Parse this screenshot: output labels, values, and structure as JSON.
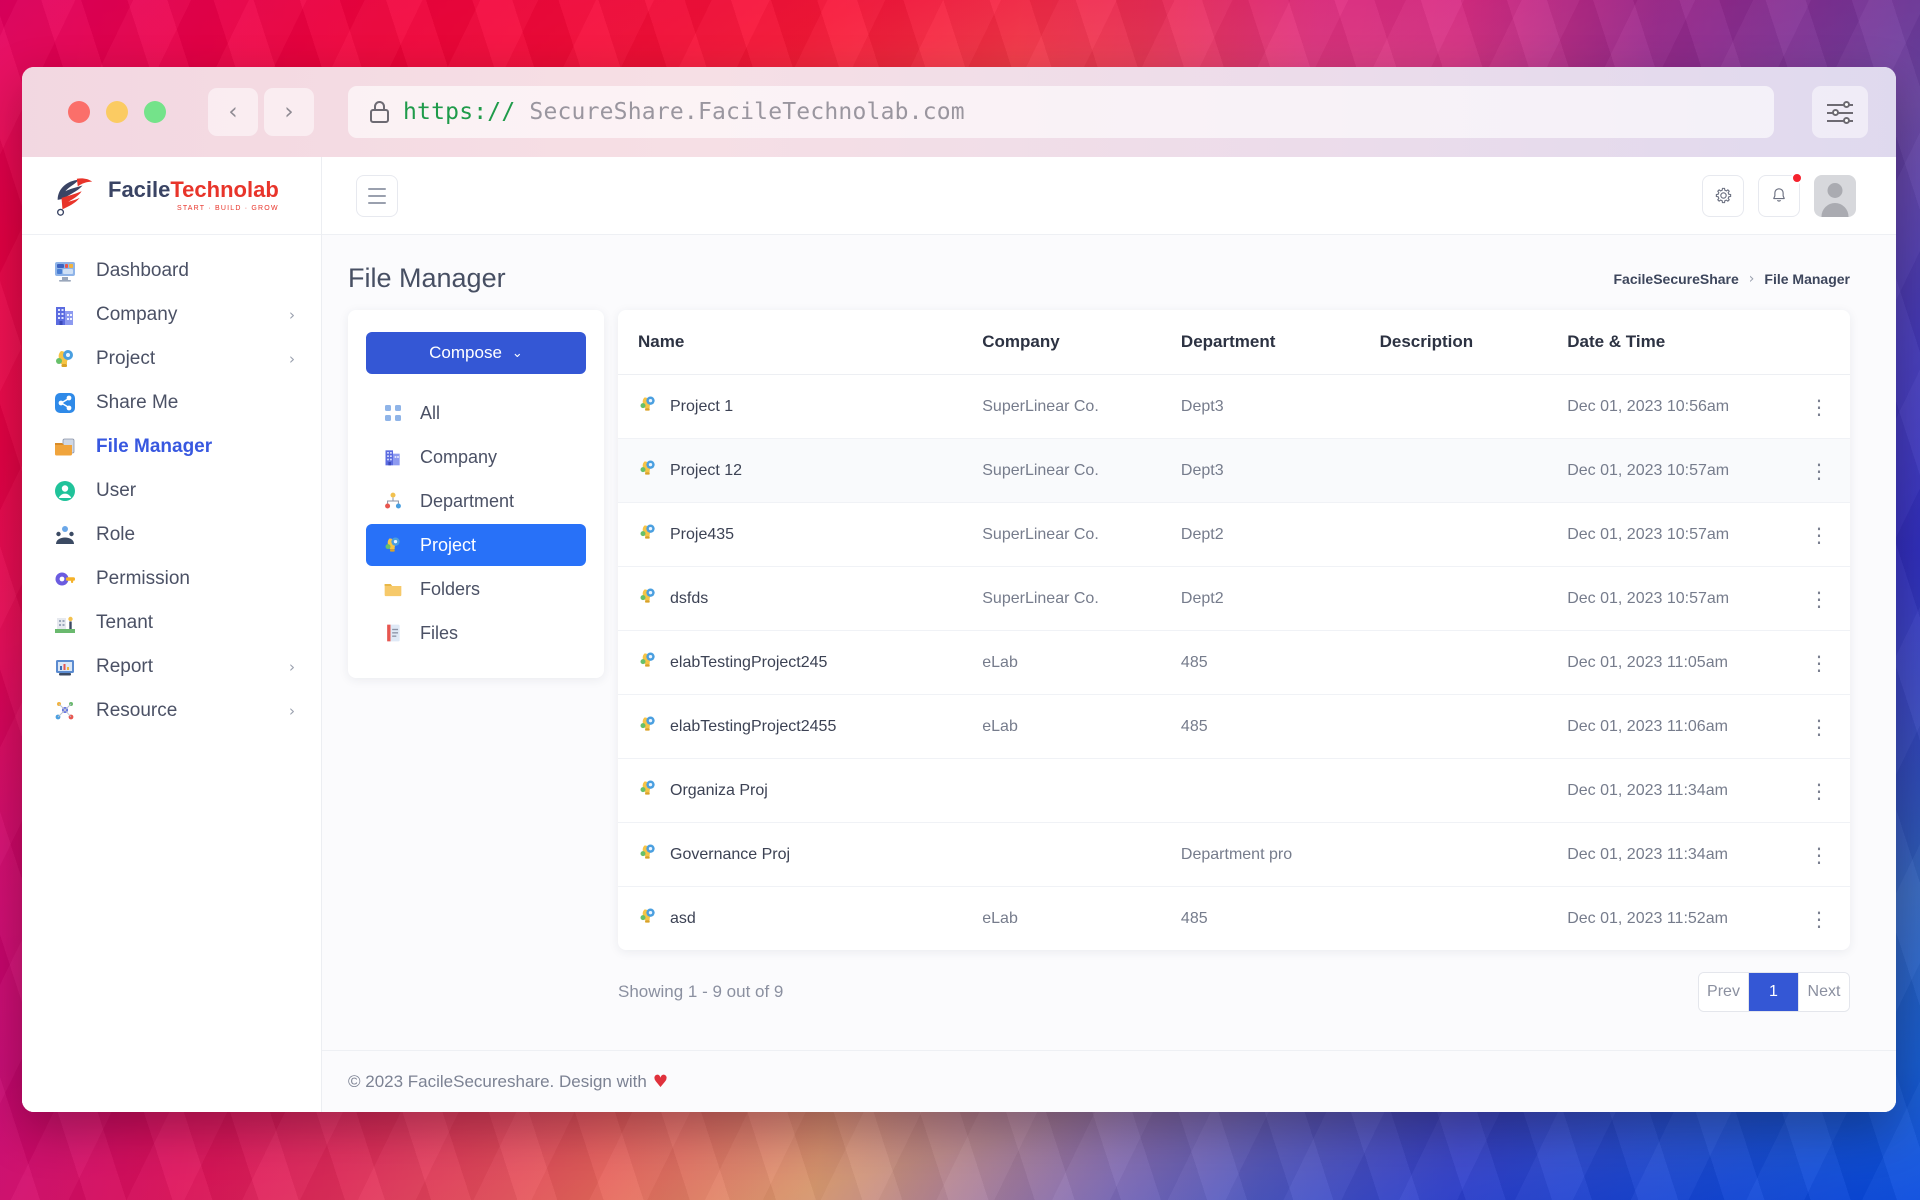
{
  "browser": {
    "traffic_lights": [
      "close",
      "minimize",
      "maximize"
    ],
    "back_label": "‹",
    "forward_label": "›",
    "url_protocol": "https://",
    "url_host": "SecureShare.FacileTechnolab.com",
    "lock_icon": "lock-icon",
    "settings_icon": "sliders-icon"
  },
  "brand": {
    "name_first": "Facile",
    "name_second": "Technolab",
    "tagline": "START · BUILD · GROW"
  },
  "sidebar": {
    "items": [
      {
        "label": "Dashboard",
        "icon": "dashboard-icon",
        "caret": "",
        "active": false
      },
      {
        "label": "Company",
        "icon": "company-icon",
        "caret": "›",
        "active": false
      },
      {
        "label": "Project",
        "icon": "project-icon",
        "caret": "›",
        "active": false
      },
      {
        "label": "Share Me",
        "icon": "share-icon",
        "caret": "",
        "active": false
      },
      {
        "label": "File Manager",
        "icon": "file-manager-icon",
        "caret": "",
        "active": true
      },
      {
        "label": "User",
        "icon": "user-icon",
        "caret": "",
        "active": false
      },
      {
        "label": "Role",
        "icon": "role-icon",
        "caret": "",
        "active": false
      },
      {
        "label": "Permission",
        "icon": "permission-icon",
        "caret": "",
        "active": false
      },
      {
        "label": "Tenant",
        "icon": "tenant-icon",
        "caret": "",
        "active": false
      },
      {
        "label": "Report",
        "icon": "report-icon",
        "caret": "›",
        "active": false
      },
      {
        "label": "Resource",
        "icon": "resource-icon",
        "caret": "›",
        "active": false
      }
    ]
  },
  "topbar": {
    "menu_toggle": "hamburger-icon",
    "settings_icon": "gear-icon",
    "notifications_icon": "bell-icon",
    "has_notification": true,
    "avatar": "user-avatar"
  },
  "page": {
    "title": "File Manager",
    "breadcrumb": [
      "FacileSecureShare",
      "File Manager"
    ],
    "breadcrumb_separator": "›"
  },
  "filter_panel": {
    "compose_label": "Compose",
    "compose_caret": "⌄",
    "items": [
      {
        "label": "All",
        "icon": "grid-icon",
        "active": false
      },
      {
        "label": "Company",
        "icon": "company-icon",
        "active": false
      },
      {
        "label": "Department",
        "icon": "department-icon",
        "active": false
      },
      {
        "label": "Project",
        "icon": "project-icon",
        "active": true
      },
      {
        "label": "Folders",
        "icon": "folder-icon",
        "active": false
      },
      {
        "label": "Files",
        "icon": "file-icon",
        "active": false
      }
    ]
  },
  "table": {
    "columns": [
      "Name",
      "Company",
      "Department",
      "Description",
      "Date & Time"
    ],
    "row_icon": "project-icon",
    "row_menu_icon": "kebab-menu-icon",
    "rows": [
      {
        "name": "Project 1",
        "company": "SuperLinear Co.",
        "department": "Dept3",
        "description": "",
        "datetime": "Dec 01, 2023 10:56am"
      },
      {
        "name": "Project 12",
        "company": "SuperLinear Co.",
        "department": "Dept3",
        "description": "",
        "datetime": "Dec 01, 2023 10:57am"
      },
      {
        "name": "Proje435",
        "company": "SuperLinear Co.",
        "department": "Dept2",
        "description": "",
        "datetime": "Dec 01, 2023 10:57am"
      },
      {
        "name": "dsfds",
        "company": "SuperLinear Co.",
        "department": "Dept2",
        "description": "",
        "datetime": "Dec 01, 2023 10:57am"
      },
      {
        "name": "elabTestingProject245",
        "company": "eLab",
        "department": "485",
        "description": "",
        "datetime": "Dec 01, 2023 11:05am"
      },
      {
        "name": "elabTestingProject2455",
        "company": "eLab",
        "department": "485",
        "description": "",
        "datetime": "Dec 01, 2023 11:06am"
      },
      {
        "name": "Organiza Proj",
        "company": "",
        "department": "",
        "description": "",
        "datetime": "Dec 01, 2023 11:34am"
      },
      {
        "name": "Governance Proj",
        "company": "",
        "department": "Department pro",
        "description": "",
        "datetime": "Dec 01, 2023 11:34am"
      },
      {
        "name": "asd",
        "company": "eLab",
        "department": "485",
        "description": "",
        "datetime": "Dec 01, 2023 11:52am"
      }
    ],
    "highlight_row_index": 1
  },
  "pagination": {
    "showing": "Showing 1 - 9 out of 9",
    "prev_label": "Prev",
    "next_label": "Next",
    "pages": [
      "1"
    ],
    "current_page": "1"
  },
  "footer": {
    "text": "© 2023 FacileSecureshare. Design with",
    "heart": "♥"
  },
  "colors": {
    "primary": "#3457d5",
    "active_filter": "#2871f8",
    "brand_red": "#e8342a",
    "brand_navy": "#3a4464",
    "link_blue": "#3858e0",
    "notification": "#f5222d",
    "heart": "#e0313c",
    "url_green": "#1f9b4a"
  }
}
